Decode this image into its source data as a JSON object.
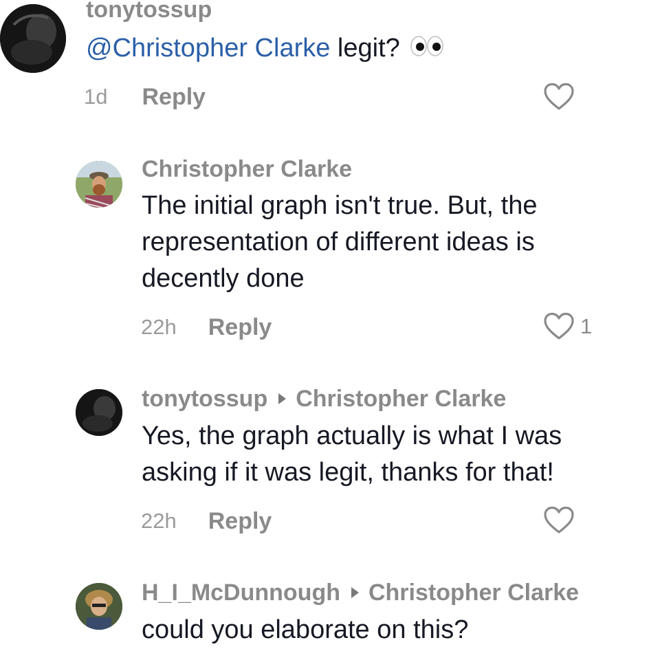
{
  "comments": [
    {
      "author": "tonytossup",
      "reply_to": "",
      "mention": "@Christopher Clarke",
      "text": " legit? ",
      "emoji": "eyes-emoji",
      "time": "1d",
      "reply_label": "Reply",
      "likes": ""
    },
    {
      "author": "Christopher Clarke",
      "reply_to": "",
      "text_lines": [
        "The initial graph isn't true. But, the",
        "representation of different ideas is",
        "decently done"
      ],
      "time": "22h",
      "reply_label": "Reply",
      "likes": "1"
    },
    {
      "author": "tonytossup",
      "reply_to": "Christopher Clarke",
      "text_lines": [
        "Yes, the graph actually is what I was",
        "asking if it was legit, thanks for that!"
      ],
      "time": "22h",
      "reply_label": "Reply",
      "likes": ""
    },
    {
      "author": "H_I_McDunnough",
      "reply_to": "Christopher Clarke",
      "text_lines": [
        "could you elaborate on this?"
      ]
    }
  ],
  "colors": {
    "text": "#161823",
    "muted": "#8a8a8a",
    "mention": "#2b5fa8",
    "background": "#ffffff"
  },
  "icons": {
    "like": "heart-outline-icon",
    "reply_indicator": "triangle-right-icon"
  }
}
